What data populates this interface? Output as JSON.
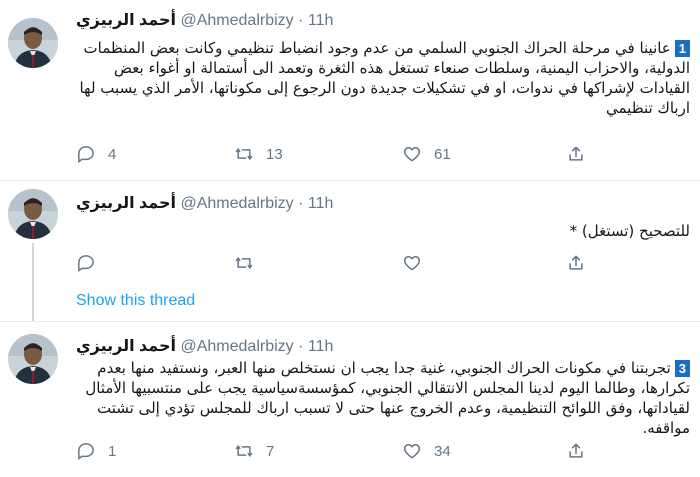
{
  "tweets": [
    {
      "name": "أحمد الربيزي",
      "handle": "@Ahmedalrbizy",
      "dot": "·",
      "time": "11h",
      "badge": "1",
      "text": "عانينا في مرحلة الحراك الجنوبي السلمي من عدم وجود انضباط تنظيمي وكانت بعض المنظمات الدولية، والاحزاب اليمنية، وسلطات صنعاء تستغل هذه الثغرة وتعمد الى أستمالة او أغواء بعض القيادات لإشراكها في ندوات، او في تشكيلات جديدة دون الرجوع إلى مكوناتها، الأمر الذي يسبب لها ارباك تنظيمي",
      "replies": "4",
      "retweets": "13",
      "likes": "61"
    },
    {
      "name": "أحمد الربيزي",
      "handle": "@Ahmedalrbizy",
      "dot": "·",
      "time": "11h",
      "text": "للتصحيح (تستغل) *",
      "replies": "",
      "retweets": "",
      "likes": ""
    },
    {
      "name": "أحمد الربيزي",
      "handle": "@Ahmedalrbizy",
      "dot": "·",
      "time": "11h",
      "badge": "3",
      "text": "تجربتنا في مكونات الحراك الجنوبي، غنية جدا يجب ان نستخلص منها العبر، ونستفيد منها بعدم تكرارها، وطالما اليوم لدينا المجلس الانتقالي الجنوبي، كمؤسسةسياسية يجب على منتسبيها الأمثال لقياداتها، وفق اللوائح التنظيمية، وعدم الخروج عنها حتى لا تسبب ارباك للمجلس تؤدي إلى تشتت مواقفه.",
      "replies": "1",
      "retweets": "7",
      "likes": "34"
    }
  ],
  "show_thread": "Show this thread",
  "colors": {
    "accent": "#1da1f2",
    "muted": "#657786",
    "badge": "#1b6ec2"
  }
}
